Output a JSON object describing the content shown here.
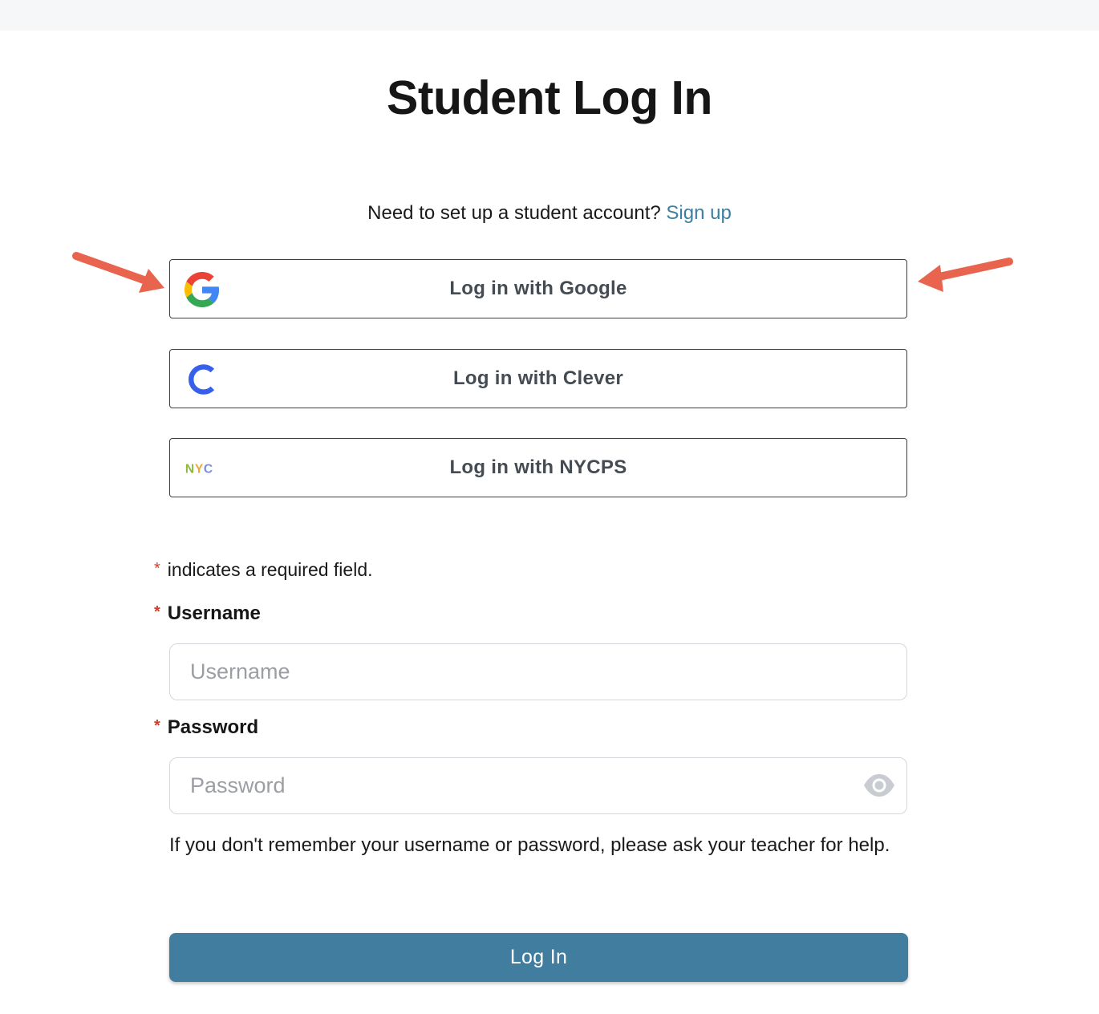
{
  "page": {
    "title": "Student Log In"
  },
  "signup": {
    "prompt": "Need to set up a student account?",
    "link_label": "Sign up"
  },
  "sso": {
    "google_label": "Log in with Google",
    "clever_label": "Log in with Clever",
    "nycps_label": "Log in with NYCPS",
    "nycps_logo_text": "NYC"
  },
  "form": {
    "required_note": "indicates a required field.",
    "required_marker": "*",
    "username_label": "Username",
    "username_placeholder": "Username",
    "password_label": "Password",
    "password_placeholder": "Password",
    "help_text": "If you don't remember your username or password, please ask your teacher for help.",
    "submit_label": "Log In"
  },
  "icons": {
    "google": "google-g-icon",
    "clever": "clever-c-icon",
    "nycps": "nyc-logo-icon",
    "show_password": "eye-icon",
    "annotation": "red-arrow-icon"
  },
  "colors": {
    "link": "#3b7fa3",
    "primary_button": "#417d9f",
    "required_star": "#d43c2c",
    "annotation_arrow": "#e8644f",
    "clever_blue": "#3660eb"
  }
}
